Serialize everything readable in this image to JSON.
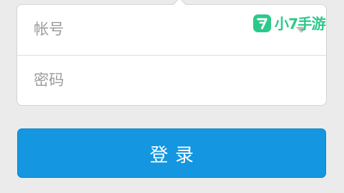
{
  "login_form": {
    "account_placeholder": "帐号",
    "password_placeholder": "密码"
  },
  "login_button": {
    "label": "登录"
  },
  "watermark": {
    "logo_glyph": "7",
    "text": "小7手游",
    "color": "#2cc98a"
  },
  "colors": {
    "accent": "#1496e0",
    "background": "#ebebeb"
  }
}
